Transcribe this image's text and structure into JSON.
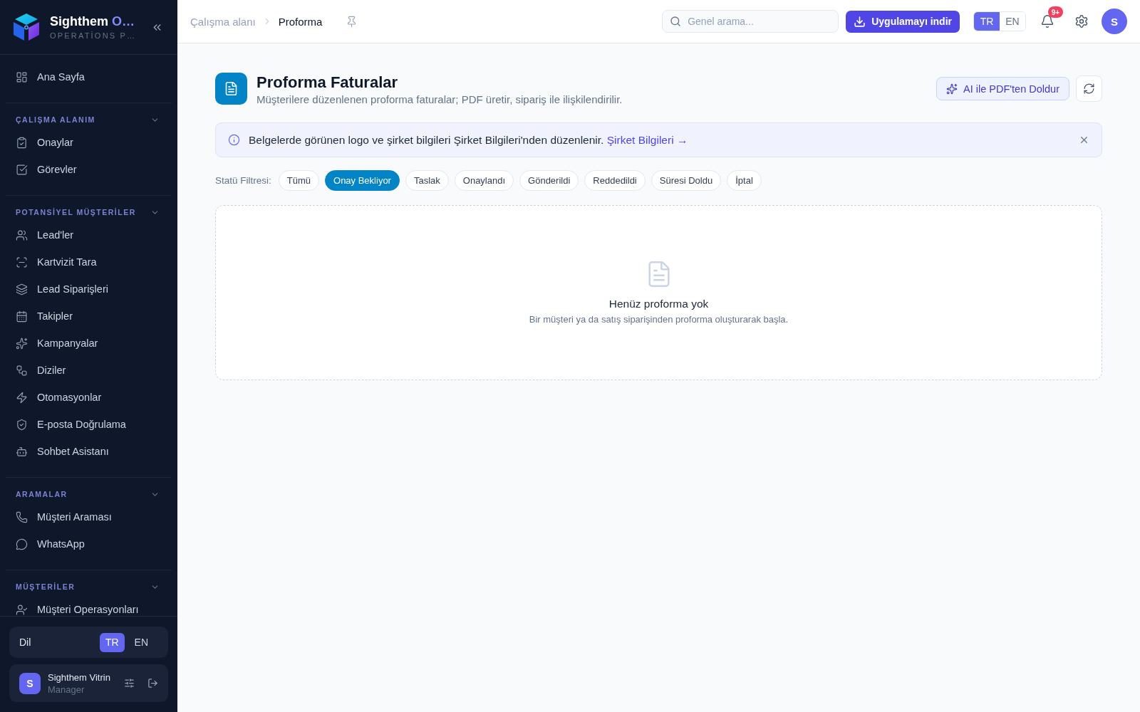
{
  "sidebar": {
    "brand": {
      "name": "Sighthem",
      "name_accent": "O…",
      "tagline": "OPERATİONS P…"
    },
    "home": {
      "label": "Ana Sayfa"
    },
    "groups": [
      {
        "title": "ÇALIŞMA ALANIM",
        "expanded": true,
        "items": [
          {
            "label": "Onaylar"
          },
          {
            "label": "Görevler"
          }
        ]
      },
      {
        "title": "POTANSİYEL MÜŞTERİLER",
        "expanded": true,
        "items": [
          {
            "label": "Lead'ler"
          },
          {
            "label": "Kartvizit Tara"
          },
          {
            "label": "Lead Siparişleri"
          },
          {
            "label": "Takipler"
          },
          {
            "label": "Kampanyalar"
          },
          {
            "label": "Diziler"
          },
          {
            "label": "Otomasyonlar"
          },
          {
            "label": "E-posta Doğrulama"
          },
          {
            "label": "Sohbet Asistanı"
          }
        ]
      },
      {
        "title": "ARAMALAR",
        "expanded": true,
        "items": [
          {
            "label": "Müşteri Araması"
          },
          {
            "label": "WhatsApp"
          }
        ]
      },
      {
        "title": "MÜŞTERİLER",
        "expanded": true,
        "items": [
          {
            "label": "Müşteri Operasyonları"
          }
        ]
      }
    ],
    "language": {
      "label": "Dil",
      "options": [
        {
          "label": "TR",
          "selected": true
        },
        {
          "label": "EN",
          "selected": false
        }
      ]
    },
    "user": {
      "initial": "S",
      "name": "Sighthem Vitrin",
      "role": "Manager"
    }
  },
  "topbar": {
    "breadcrumb": [
      "Çalışma alanı",
      "Proforma"
    ],
    "search": {
      "placeholder": "Genel arama..."
    },
    "download_button": "Uygulamayı indir",
    "language": [
      {
        "label": "TR",
        "selected": true
      },
      {
        "label": "EN",
        "selected": false
      }
    ],
    "notifications_badge": "9+",
    "avatar": "S"
  },
  "page": {
    "title": "Proforma Faturalar",
    "subtitle": "Müşterilere düzenlenen proforma faturalar; PDF üretir, sipariş ile ilişkilendirilir.",
    "ai_button": "AI ile PDF'ten Doldur"
  },
  "banner": {
    "message": "Belgelerde görünen logo ve şirket bilgileri Şirket Bilgileri'nden düzenlenir.",
    "link": "Şirket Bilgileri →"
  },
  "filters": {
    "label": "Statü Filtresi:",
    "options": [
      {
        "label": "Tümü",
        "selected": false
      },
      {
        "label": "Onay Bekliyor",
        "selected": true
      },
      {
        "label": "Taslak",
        "selected": false
      },
      {
        "label": "Onaylandı",
        "selected": false
      },
      {
        "label": "Gönderildi",
        "selected": false
      },
      {
        "label": "Reddedildi",
        "selected": false
      },
      {
        "label": "Süresi Doldu",
        "selected": false
      },
      {
        "label": "İptal",
        "selected": false
      }
    ]
  },
  "empty_state": {
    "title": "Henüz proforma yok",
    "description": "Bir müşteri ya da satış siparişinden proforma oluşturarak başla."
  }
}
